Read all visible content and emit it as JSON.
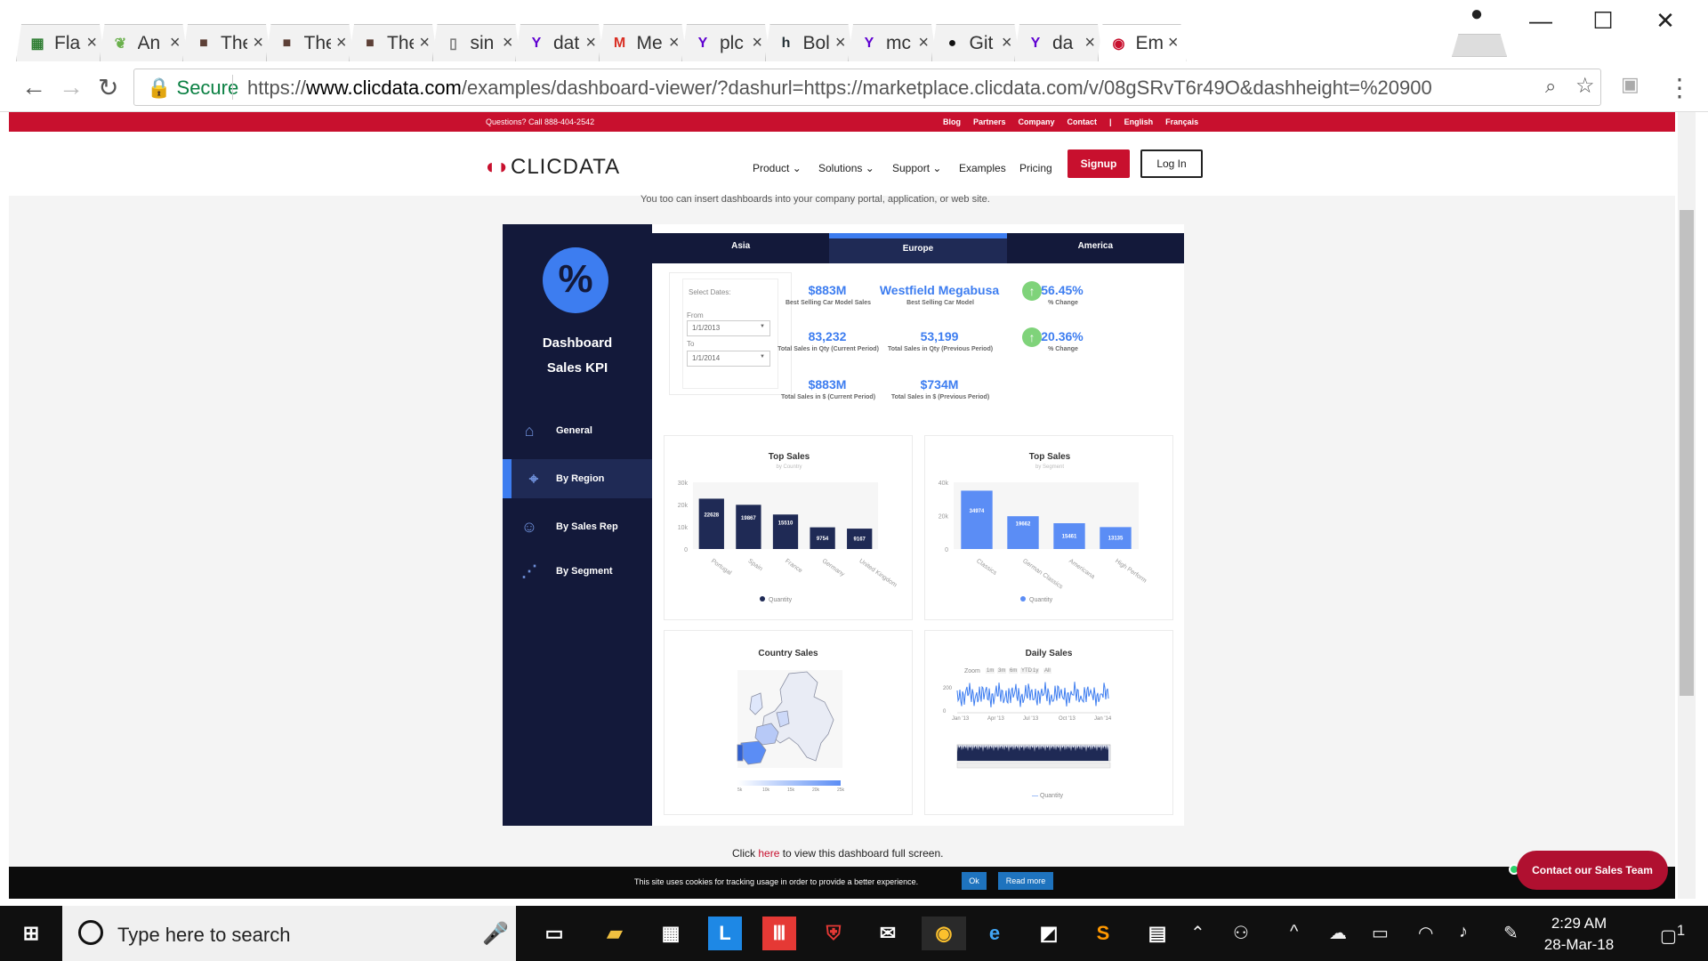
{
  "browser": {
    "tabs": [
      {
        "title": "Fla",
        "icon": "spreadsheet-icon",
        "color": "#2e7d32"
      },
      {
        "title": "An",
        "icon": "leaf-icon",
        "color": "#6ab04c"
      },
      {
        "title": "The",
        "icon": "avatar-icon",
        "color": "#5d4037"
      },
      {
        "title": "The",
        "icon": "avatar-icon",
        "color": "#5d4037"
      },
      {
        "title": "The",
        "icon": "avatar-icon",
        "color": "#5d4037"
      },
      {
        "title": "sin",
        "icon": "document-icon",
        "color": "#777777"
      },
      {
        "title": "dat",
        "icon": "yahoo-icon",
        "color": "#5f01d1"
      },
      {
        "title": "Me",
        "icon": "gmail-icon",
        "color": "#d93025"
      },
      {
        "title": "plc",
        "icon": "yahoo-icon",
        "color": "#5f01d1"
      },
      {
        "title": "Bol",
        "icon": "h-icon",
        "color": "#263238"
      },
      {
        "title": "mc",
        "icon": "yahoo-icon",
        "color": "#5f01d1"
      },
      {
        "title": "Git",
        "icon": "github-icon",
        "color": "#111111"
      },
      {
        "title": "da",
        "icon": "yahoo-icon",
        "color": "#5f01d1"
      },
      {
        "title": "Em",
        "icon": "clicdata-icon",
        "color": "#c8102e",
        "active": true
      }
    ],
    "secure_label": "Secure",
    "url_scheme": "https://",
    "url_domain": "www.clicdata.com",
    "url_rest": "/examples/dashboard-viewer/?dashurl=https://marketplace.clicdata.com/v/08gSRvT6r49O&dashheight=%20900"
  },
  "site": {
    "phone": "Questions? Call 888-404-2542",
    "top_links": [
      "Blog",
      "Partners",
      "Company",
      "Contact",
      "|",
      "English",
      "Français"
    ],
    "logo": "CLICDATA",
    "nav": [
      "Product ⌄",
      "Solutions ⌄",
      "Support ⌄",
      "Examples",
      "Pricing"
    ],
    "signup": "Signup",
    "login": "Log In",
    "tagline": "You too can insert dashboards into your company portal, application, or web site.",
    "fullscreen_prefix": "Click ",
    "fullscreen_link": "here",
    "fullscreen_suffix": " to view this dashboard full screen.",
    "cookie_msg": "This site uses cookies for tracking usage in order to provide a better experience.",
    "cookie_ok": "Ok",
    "cookie_more": "Read more",
    "contact_sales": "Contact our Sales Team"
  },
  "dashboard": {
    "badge": "%",
    "title_line1": "Dashboard",
    "title_line2": "Sales KPI",
    "menu": [
      {
        "label": "General",
        "icon": "home-icon"
      },
      {
        "label": "By Region",
        "icon": "location-pin-icon",
        "active": true
      },
      {
        "label": "By Sales Rep",
        "icon": "user-icon"
      },
      {
        "label": "By Segment",
        "icon": "share-icon"
      }
    ],
    "regions": [
      "Asia",
      "Europe",
      "America"
    ],
    "active_region": "Europe",
    "select_dates": "Select Dates:",
    "from_label": "From",
    "from_value": "1/1/2013",
    "to_label": "To",
    "to_value": "1/1/2014",
    "kpis": [
      {
        "value": "$883M",
        "label": "Best Selling Car Model Sales"
      },
      {
        "value": "Westfield Megabusa",
        "label": "Best Selling Car Model"
      },
      {
        "value": "56.45%",
        "label": "% Change"
      },
      {
        "value": "83,232",
        "label": "Total Sales in Qty (Current Period)"
      },
      {
        "value": "53,199",
        "label": "Total Sales in Qty (Previous Period)"
      },
      {
        "value": "20.36%",
        "label": "% Change"
      },
      {
        "value": "$883M",
        "label": "Total Sales in $ (Current Period)"
      },
      {
        "value": "$734M",
        "label": "Total Sales in $ (Previous Period)"
      }
    ],
    "country_sales_title": "Country Sales",
    "country_scale": [
      "5k",
      "10k",
      "15k",
      "20k",
      "25k"
    ],
    "daily_title": "Daily Sales",
    "zoom_label": "Zoom",
    "zoom_options": [
      "1m",
      "3m",
      "6m",
      "YTD",
      "1y",
      "All"
    ],
    "daily_y_ticks": [
      "200",
      "0"
    ],
    "daily_x_ticks": [
      "Jan '13",
      "Apr '13",
      "Jul '13",
      "Oct '13",
      "Jan '14"
    ],
    "daily_legend": "Quantity",
    "colors": {
      "dark": "#13193a",
      "navy": "#1f2a55",
      "accent": "#3d7df0",
      "brand": "#c8102e"
    }
  },
  "chart_data": [
    {
      "type": "bar",
      "title": "Top Sales",
      "subtitle": "by Country",
      "categories": [
        "Portugal",
        "Spain",
        "France",
        "Germany",
        "United Kingdom"
      ],
      "series": [
        {
          "name": "Quantity",
          "values": [
            22628,
            19867,
            15510,
            9754,
            9167
          ]
        }
      ],
      "yticks": [
        "30k",
        "20k",
        "10k",
        "0"
      ],
      "ylim": [
        0,
        30000
      ],
      "color": "#1f2a55"
    },
    {
      "type": "bar",
      "title": "Top Sales",
      "subtitle": "by Segment",
      "categories": [
        "Classics",
        "German Classics",
        "Americana",
        "High Perform"
      ],
      "series": [
        {
          "name": "Quantity",
          "values": [
            34974,
            19662,
            15461,
            13135
          ]
        }
      ],
      "yticks": [
        "40k",
        "20k",
        "0"
      ],
      "ylim": [
        0,
        40000
      ],
      "color": "#5b8df5"
    }
  ],
  "taskbar": {
    "search_placeholder": "Type here to search",
    "time": "2:29 AM",
    "date": "28-Mar-18",
    "notif_count": "1"
  }
}
